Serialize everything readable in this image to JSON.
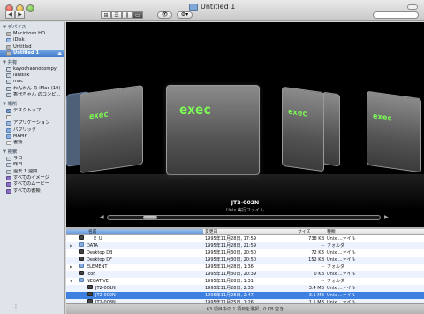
{
  "window": {
    "title": "Untitled 1"
  },
  "toolbar": {
    "back_label": "◀",
    "forward_label": "▶",
    "views": [
      "⊞",
      "☰",
      "⫼",
      "▭"
    ],
    "quicklook_label": "👁",
    "action_label": "⚙▾"
  },
  "sidebar": {
    "devices_header": "▼ デバイス",
    "devices": [
      {
        "label": "Macintosh HD",
        "icon": "disk-icon"
      },
      {
        "label": "iDisk",
        "icon": "idisk-icon"
      },
      {
        "label": "Untitled",
        "icon": "disk-icon"
      },
      {
        "label": "Untitled 1",
        "icon": "disk-icon",
        "selected": true,
        "eject": "⏏"
      }
    ],
    "shared_header": "▼ 共有",
    "shared": [
      {
        "label": "kayochannokompy",
        "icon": "monitor-icon"
      },
      {
        "label": "landisk",
        "icon": "monitor-icon"
      },
      {
        "label": "mac",
        "icon": "monitor-icon"
      },
      {
        "label": "わんわん の iMac (10)",
        "icon": "monitor-icon"
      },
      {
        "label": "香代ちゃん のコンピ...",
        "icon": "monitor-icon"
      }
    ],
    "places_header": "▼ 場所",
    "places": [
      {
        "label": "デスクトップ",
        "icon": "desktop-icon"
      },
      {
        "label": "",
        "icon": "home-icon"
      },
      {
        "label": "アプリケーション",
        "icon": "applications-icon"
      },
      {
        "label": "パブリック",
        "icon": "public-icon"
      },
      {
        "label": "MAMP",
        "icon": "folder-icon"
      },
      {
        "label": "書類",
        "icon": "documents-icon"
      }
    ],
    "search_header": "▼ 検索",
    "searches": [
      {
        "label": "今日",
        "icon": "clock-icon"
      },
      {
        "label": "昨日",
        "icon": "clock-icon"
      },
      {
        "label": "過去 1 週間",
        "icon": "clock-icon"
      },
      {
        "label": "すべてのイメージ",
        "icon": "smart-folder-icon"
      },
      {
        "label": "すべてのムービー",
        "icon": "smart-folder-icon"
      },
      {
        "label": "すべての書類",
        "icon": "smart-folder-icon"
      }
    ]
  },
  "coverflow": {
    "main_label": "exec",
    "side_label": "exec",
    "selected_name": "JT2-002N",
    "selected_kind": "Unix 実行ファイル"
  },
  "list": {
    "columns": {
      "name": "名前",
      "date": "変更日",
      "size": "サイズ",
      "kind": "種類"
    },
    "rows": [
      {
        "name": "._ _E_U",
        "date": "1995年11月28日, 17:59",
        "size": "738 KB",
        "kind": "Unix ...ァイル",
        "type": "file",
        "indent": 0
      },
      {
        "name": "DATA",
        "date": "1995年11月28日, 21:59",
        "size": "--",
        "kind": "フォルダ",
        "type": "folder",
        "expand": "▶",
        "indent": 0
      },
      {
        "name": "Desktop DB",
        "date": "1995年11月30日, 20:50",
        "size": "72 KB",
        "kind": "Unix ...ァイル",
        "type": "file",
        "indent": 0
      },
      {
        "name": "Desktop DF",
        "date": "1995年11月30日, 20:50",
        "size": "152 KB",
        "kind": "Unix ...ァイル",
        "type": "file",
        "indent": 0
      },
      {
        "name": "ELEMENT",
        "date": "1995年11月28日, 1:36",
        "size": "--",
        "kind": "フォルダ",
        "type": "folder",
        "expand": "▶",
        "indent": 0
      },
      {
        "name": "Icon",
        "date": "1995年11月30日, 20:39",
        "size": "0 KB",
        "kind": "Unix ...ァイル",
        "type": "file",
        "indent": 0
      },
      {
        "name": "NEGATIVE",
        "date": "1995年11月28日, 1:31",
        "size": "--",
        "kind": "フォルダ",
        "type": "folder",
        "expand": "▼",
        "indent": 0
      },
      {
        "name": "JT2-001N",
        "date": "1995年11月28日, 2:35",
        "size": "3.4 MB",
        "kind": "Unix ...ァイル",
        "type": "file",
        "indent": 1
      },
      {
        "name": "JT2-002N",
        "date": "1995年11月28日, 2:47",
        "size": "3.1 MB",
        "kind": "Unix ...ァイル",
        "type": "file",
        "indent": 1,
        "selected": true
      },
      {
        "name": "JT2-003N",
        "date": "1995年11月25日, 1:26",
        "size": "1.1 MB",
        "kind": "Unix ...ァイル",
        "type": "file",
        "indent": 1
      }
    ]
  },
  "status": {
    "text": "63 項目中の 1 項目を選択、0 KB 空き"
  },
  "colors": {
    "selection": "#3d80df",
    "sidebar_bg": "#dfe4ea",
    "cover_text": "#7cff52"
  }
}
